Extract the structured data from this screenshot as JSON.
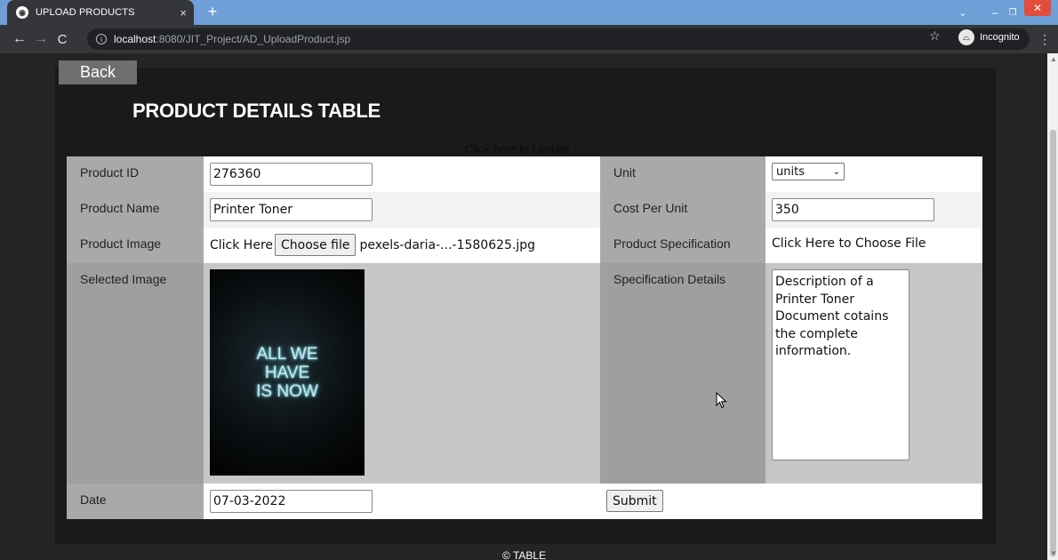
{
  "browser": {
    "tab_title": "UPLOAD PRODUCTS",
    "tab_close": "×",
    "new_tab": "+",
    "url_host": "localhost",
    "url_path": ":8080/JIT_Project/AD_UploadProduct.jsp",
    "incognito_label": "Incognito"
  },
  "page": {
    "back_label": "Back",
    "title": "PRODUCT DETAILS TABLE",
    "update_link": "Click here to Update",
    "footer": "© TABLE"
  },
  "form": {
    "product_id_label": "Product ID",
    "product_id_value": "276360",
    "unit_label": "Unit",
    "unit_value": "units",
    "product_name_label": "Product Name",
    "product_name_value": "Printer Toner",
    "cost_label": "Cost Per Unit",
    "cost_value": "350",
    "product_image_label": "Product Image",
    "click_here": "Click Here",
    "choose_file": "Choose file",
    "file_name": "pexels-daria-...-1580625.jpg",
    "spec_label": "Product Specification",
    "spec_choose": "Click Here to Choose File",
    "selected_image_label": "Selected Image",
    "image_text_1": "ALL WE",
    "image_text_2": "HAVE",
    "image_text_3": "IS NOW",
    "spec_details_label": "Specification Details",
    "spec_details_value": "Description of a Printer Toner Document cotains the complete information.",
    "date_label": "Date",
    "date_value": "07-03-2022",
    "submit_label": "Submit"
  }
}
